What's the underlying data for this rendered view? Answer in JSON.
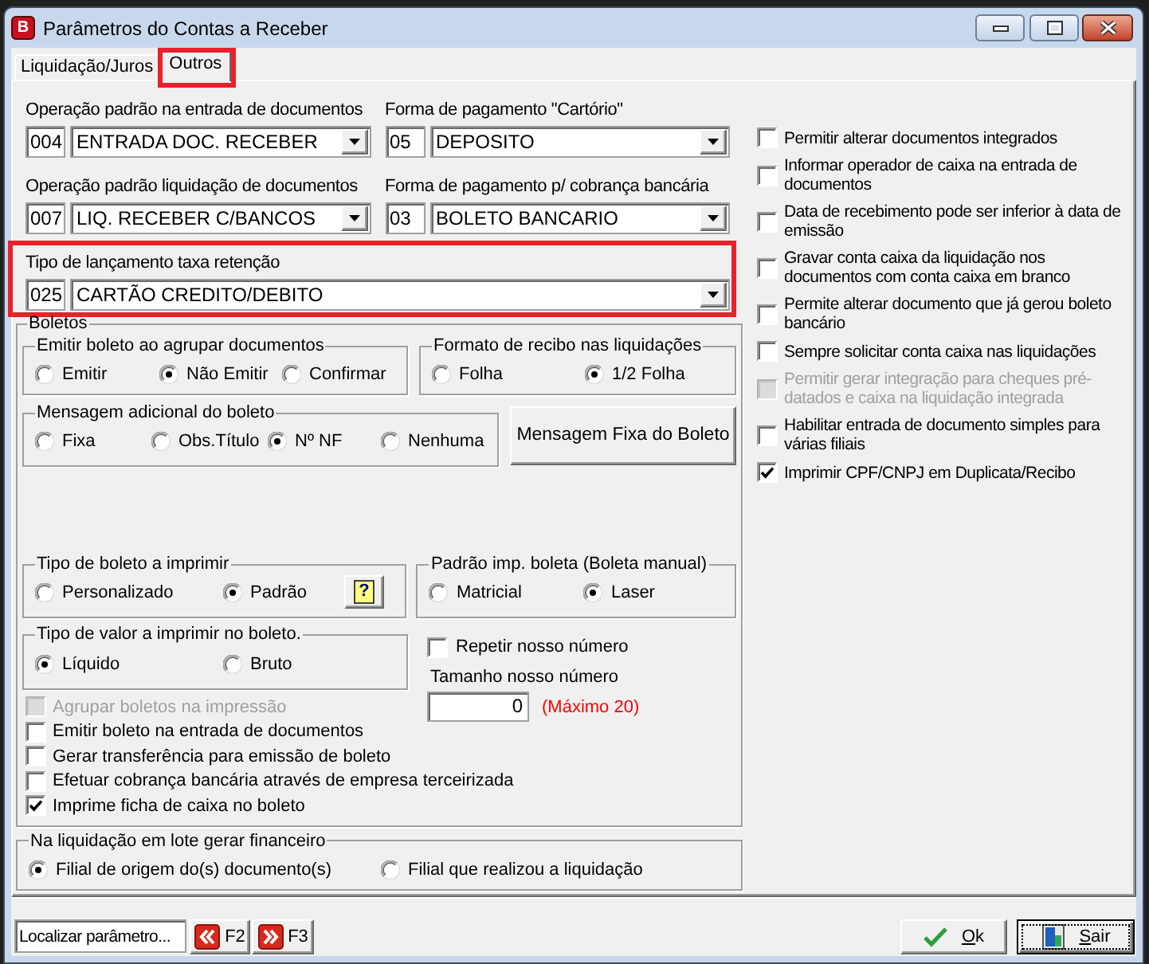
{
  "window": {
    "title": "Parâmetros do Contas a Receber",
    "icon_letter": "B"
  },
  "tabs": [
    {
      "label": "Liquidação/Juros",
      "selected": false,
      "highlighted": false
    },
    {
      "label": "Outros",
      "selected": true,
      "highlighted": true
    }
  ],
  "lookup_rows": [
    {
      "highlighted": false,
      "fields": [
        {
          "label": "Operação padrão na entrada de documentos",
          "code": "004",
          "value": "ENTRADA DOC. RECEBER"
        },
        {
          "label": "Forma de pagamento \"Cartório\"",
          "code": "05",
          "value": "DEPOSITO"
        }
      ]
    },
    {
      "highlighted": false,
      "fields": [
        {
          "label": "Operação padrão liquidação de documentos",
          "code": "007",
          "value": "LIQ. RECEBER C/BANCOS"
        },
        {
          "label": "Forma de pagamento p/ cobrança bancária",
          "code": "03",
          "value": "BOLETO BANCARIO"
        }
      ]
    },
    {
      "highlighted": true,
      "fields": [
        {
          "label": "Tipo de lançamento taxa retenção",
          "code": "025",
          "value": "CARTÃO CREDITO/DEBITO"
        }
      ]
    }
  ],
  "boletos": {
    "title": "Boletos",
    "emit_on_grouping": {
      "title": "Emitir boleto ao agrupar documentos",
      "options": [
        {
          "label": "Emitir",
          "selected": false
        },
        {
          "label": "Não Emitir",
          "selected": true
        },
        {
          "label": "Confirmar",
          "selected": false
        }
      ]
    },
    "receipt_format": {
      "title": "Formato de recibo nas liquidações",
      "options": [
        {
          "label": "Folha",
          "selected": false
        },
        {
          "label": "1/2 Folha",
          "selected": true
        }
      ]
    },
    "additional_message": {
      "title": "Mensagem adicional do boleto",
      "options": [
        {
          "label": "Fixa",
          "selected": false
        },
        {
          "label": "Obs.Título",
          "selected": false
        },
        {
          "label": "Nº NF",
          "selected": true
        },
        {
          "label": "Nenhuma",
          "selected": false
        }
      ]
    },
    "fixed_message_button": "Mensagem Fixa do Boleto",
    "boleto_type": {
      "title": "Tipo de boleto a imprimir",
      "options": [
        {
          "label": "Personalizado",
          "selected": false
        },
        {
          "label": "Padrão",
          "selected": true
        }
      ],
      "help_button": "?"
    },
    "print_default": {
      "title": "Padrão imp. boleta (Boleta manual)",
      "options": [
        {
          "label": "Matricial",
          "selected": false
        },
        {
          "label": "Laser",
          "selected": true
        }
      ]
    },
    "value_type": {
      "title": "Tipo de valor a imprimir no boleto.",
      "options": [
        {
          "label": "Líquido",
          "selected": true
        },
        {
          "label": "Bruto",
          "selected": false
        }
      ]
    },
    "repeat_number": {
      "label": "Repetir nosso número",
      "checked": false
    },
    "number_size": {
      "label": "Tamanho nosso número",
      "value": "0",
      "note": "(Máximo 20)"
    },
    "checkboxes": [
      {
        "label": "Agrupar boletos na impressão",
        "checked": false,
        "disabled": true
      },
      {
        "label": "Emitir boleto na entrada de documentos",
        "checked": false,
        "disabled": false
      },
      {
        "label": "Gerar transferência para emissão de boleto",
        "checked": false,
        "disabled": false
      },
      {
        "label": "Efetuar cobrança bancária através de empresa terceirizada",
        "checked": false,
        "disabled": false
      },
      {
        "label": "Imprime ficha de caixa no boleto",
        "checked": true,
        "disabled": false
      }
    ]
  },
  "batch_settlement": {
    "title": "Na liquidação em lote gerar financeiro",
    "options": [
      {
        "label": "Filial de origem do(s) documento(s)",
        "selected": true
      },
      {
        "label": "Filial que realizou a liquidação",
        "selected": false
      }
    ]
  },
  "options": [
    {
      "label": "Permitir alterar documentos integrados",
      "checked": false,
      "disabled": false
    },
    {
      "label": "Informar operador de caixa na entrada de documentos",
      "checked": false,
      "disabled": false
    },
    {
      "label": "Data de recebimento pode ser inferior à data de emissão",
      "checked": false,
      "disabled": false
    },
    {
      "label": "Gravar conta caixa da liquidação nos documentos com conta caixa em branco",
      "checked": false,
      "disabled": false
    },
    {
      "label": "Permite alterar documento que já gerou boleto bancário",
      "checked": false,
      "disabled": false
    },
    {
      "label": "Sempre solicitar conta caixa nas liquidações",
      "checked": false,
      "disabled": false
    },
    {
      "label": "Permitir gerar integração para cheques pré-datados e caixa na liquidação integrada",
      "checked": false,
      "disabled": true
    },
    {
      "label": "Habilitar entrada de documento simples para várias filiais",
      "checked": false,
      "disabled": false
    },
    {
      "label": "Imprimir CPF/CNPJ em Duplicata/Recibo",
      "checked": true,
      "disabled": false
    }
  ],
  "footer": {
    "search": {
      "placeholder": "Localizar parâmetro..."
    },
    "nav_buttons": [
      {
        "label": "F2",
        "kind": "previous"
      },
      {
        "label": "F3",
        "kind": "next"
      }
    ],
    "buttons": [
      {
        "label": "Ok",
        "kind": "ok",
        "default": false
      },
      {
        "label": "Sair",
        "kind": "exit",
        "default": true
      }
    ]
  }
}
